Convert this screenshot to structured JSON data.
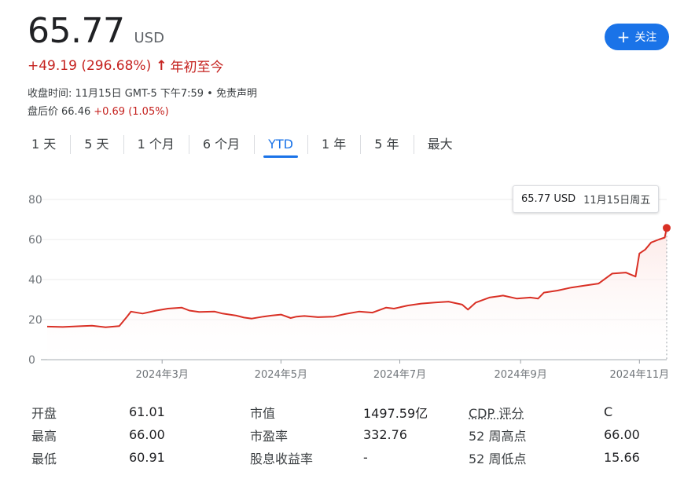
{
  "quote": {
    "price": "65.77",
    "currency": "USD",
    "change": "+49.19 (296.68%)",
    "change_arrow": "↑",
    "change_period": "年初至今",
    "close_time": "收盘时间: 11月15日 GMT-5 下午7:59 • 免责声明",
    "after_hours_label": "盘后价",
    "after_hours_price": "66.46",
    "after_hours_change": "+0.69 (1.05%)"
  },
  "follow_button": {
    "icon": "plus-icon",
    "label": "关注"
  },
  "tabs": [
    {
      "label": "1 天",
      "active": false
    },
    {
      "label": "5 天",
      "active": false
    },
    {
      "label": "1 个月",
      "active": false
    },
    {
      "label": "6 个月",
      "active": false
    },
    {
      "label": "YTD",
      "active": true
    },
    {
      "label": "1 年",
      "active": false
    },
    {
      "label": "5 年",
      "active": false
    },
    {
      "label": "最大",
      "active": false
    }
  ],
  "tooltip": {
    "value": "65.77 USD",
    "date": "11月15日周五"
  },
  "colors": {
    "accent": "#1a73e8",
    "down_red": "#d93025",
    "line": "#d93025"
  },
  "chart_data": {
    "type": "area",
    "title": "",
    "xlabel": "",
    "ylabel": "",
    "ylim": [
      0,
      80
    ],
    "yticks": [
      0,
      20,
      40,
      60,
      80
    ],
    "xticks": [
      {
        "label": "2024年3月",
        "x": "2024-03-01"
      },
      {
        "label": "2024年5月",
        "x": "2024-05-01"
      },
      {
        "label": "2024年7月",
        "x": "2024-07-01"
      },
      {
        "label": "2024年9月",
        "x": "2024-09-01"
      },
      {
        "label": "2024年11月",
        "x": "2024-11-01"
      }
    ],
    "x_range": [
      "2024-01-02",
      "2024-11-15"
    ],
    "grid": true,
    "series": [
      {
        "x": [
          "2024-01-02",
          "2024-01-10",
          "2024-01-20",
          "2024-01-25",
          "2024-02-01",
          "2024-02-08",
          "2024-02-12",
          "2024-02-14",
          "2024-02-20",
          "2024-02-27",
          "2024-03-04",
          "2024-03-11",
          "2024-03-15",
          "2024-03-20",
          "2024-03-28",
          "2024-04-01",
          "2024-04-08",
          "2024-04-12",
          "2024-04-16",
          "2024-04-22",
          "2024-04-26",
          "2024-05-01",
          "2024-05-06",
          "2024-05-09",
          "2024-05-13",
          "2024-05-20",
          "2024-05-28",
          "2024-06-03",
          "2024-06-10",
          "2024-06-17",
          "2024-06-24",
          "2024-06-28",
          "2024-07-05",
          "2024-07-12",
          "2024-07-19",
          "2024-07-26",
          "2024-08-02",
          "2024-08-05",
          "2024-08-09",
          "2024-08-16",
          "2024-08-23",
          "2024-08-30",
          "2024-09-06",
          "2024-09-10",
          "2024-09-13",
          "2024-09-20",
          "2024-09-27",
          "2024-10-04",
          "2024-10-11",
          "2024-10-18",
          "2024-10-25",
          "2024-10-30",
          "2024-11-01",
          "2024-11-04",
          "2024-11-07",
          "2024-11-11",
          "2024-11-14",
          "2024-11-15"
        ],
        "values": [
          16.5,
          16.3,
          16.8,
          17.0,
          16.2,
          16.8,
          21.5,
          24.0,
          23.0,
          24.5,
          25.5,
          26.0,
          24.5,
          23.8,
          24.0,
          23.0,
          22.0,
          21.0,
          20.5,
          21.5,
          22.0,
          22.5,
          20.8,
          21.5,
          21.8,
          21.2,
          21.5,
          22.8,
          24.0,
          23.5,
          26.0,
          25.5,
          27.0,
          28.0,
          28.5,
          29.0,
          27.5,
          25.0,
          28.5,
          31.0,
          32.0,
          30.5,
          31.0,
          30.5,
          33.5,
          34.5,
          36.0,
          37.0,
          38.0,
          43.0,
          43.5,
          41.5,
          53.0,
          55.0,
          58.5,
          60.0,
          61.0,
          65.77
        ]
      }
    ]
  },
  "stats": [
    {
      "k1": "开盘",
      "v1": "61.01",
      "k2": "市值",
      "v2": "1497.59亿",
      "k3": "CDP 评分",
      "v3": "C"
    },
    {
      "k1": "最高",
      "v1": "66.00",
      "k2": "市盈率",
      "v2": "332.76",
      "k3": "52 周高点",
      "v3": "66.00"
    },
    {
      "k1": "最低",
      "v1": "60.91",
      "k2": "股息收益率",
      "v2": "-",
      "k3": "52 周低点",
      "v3": "15.66"
    }
  ]
}
